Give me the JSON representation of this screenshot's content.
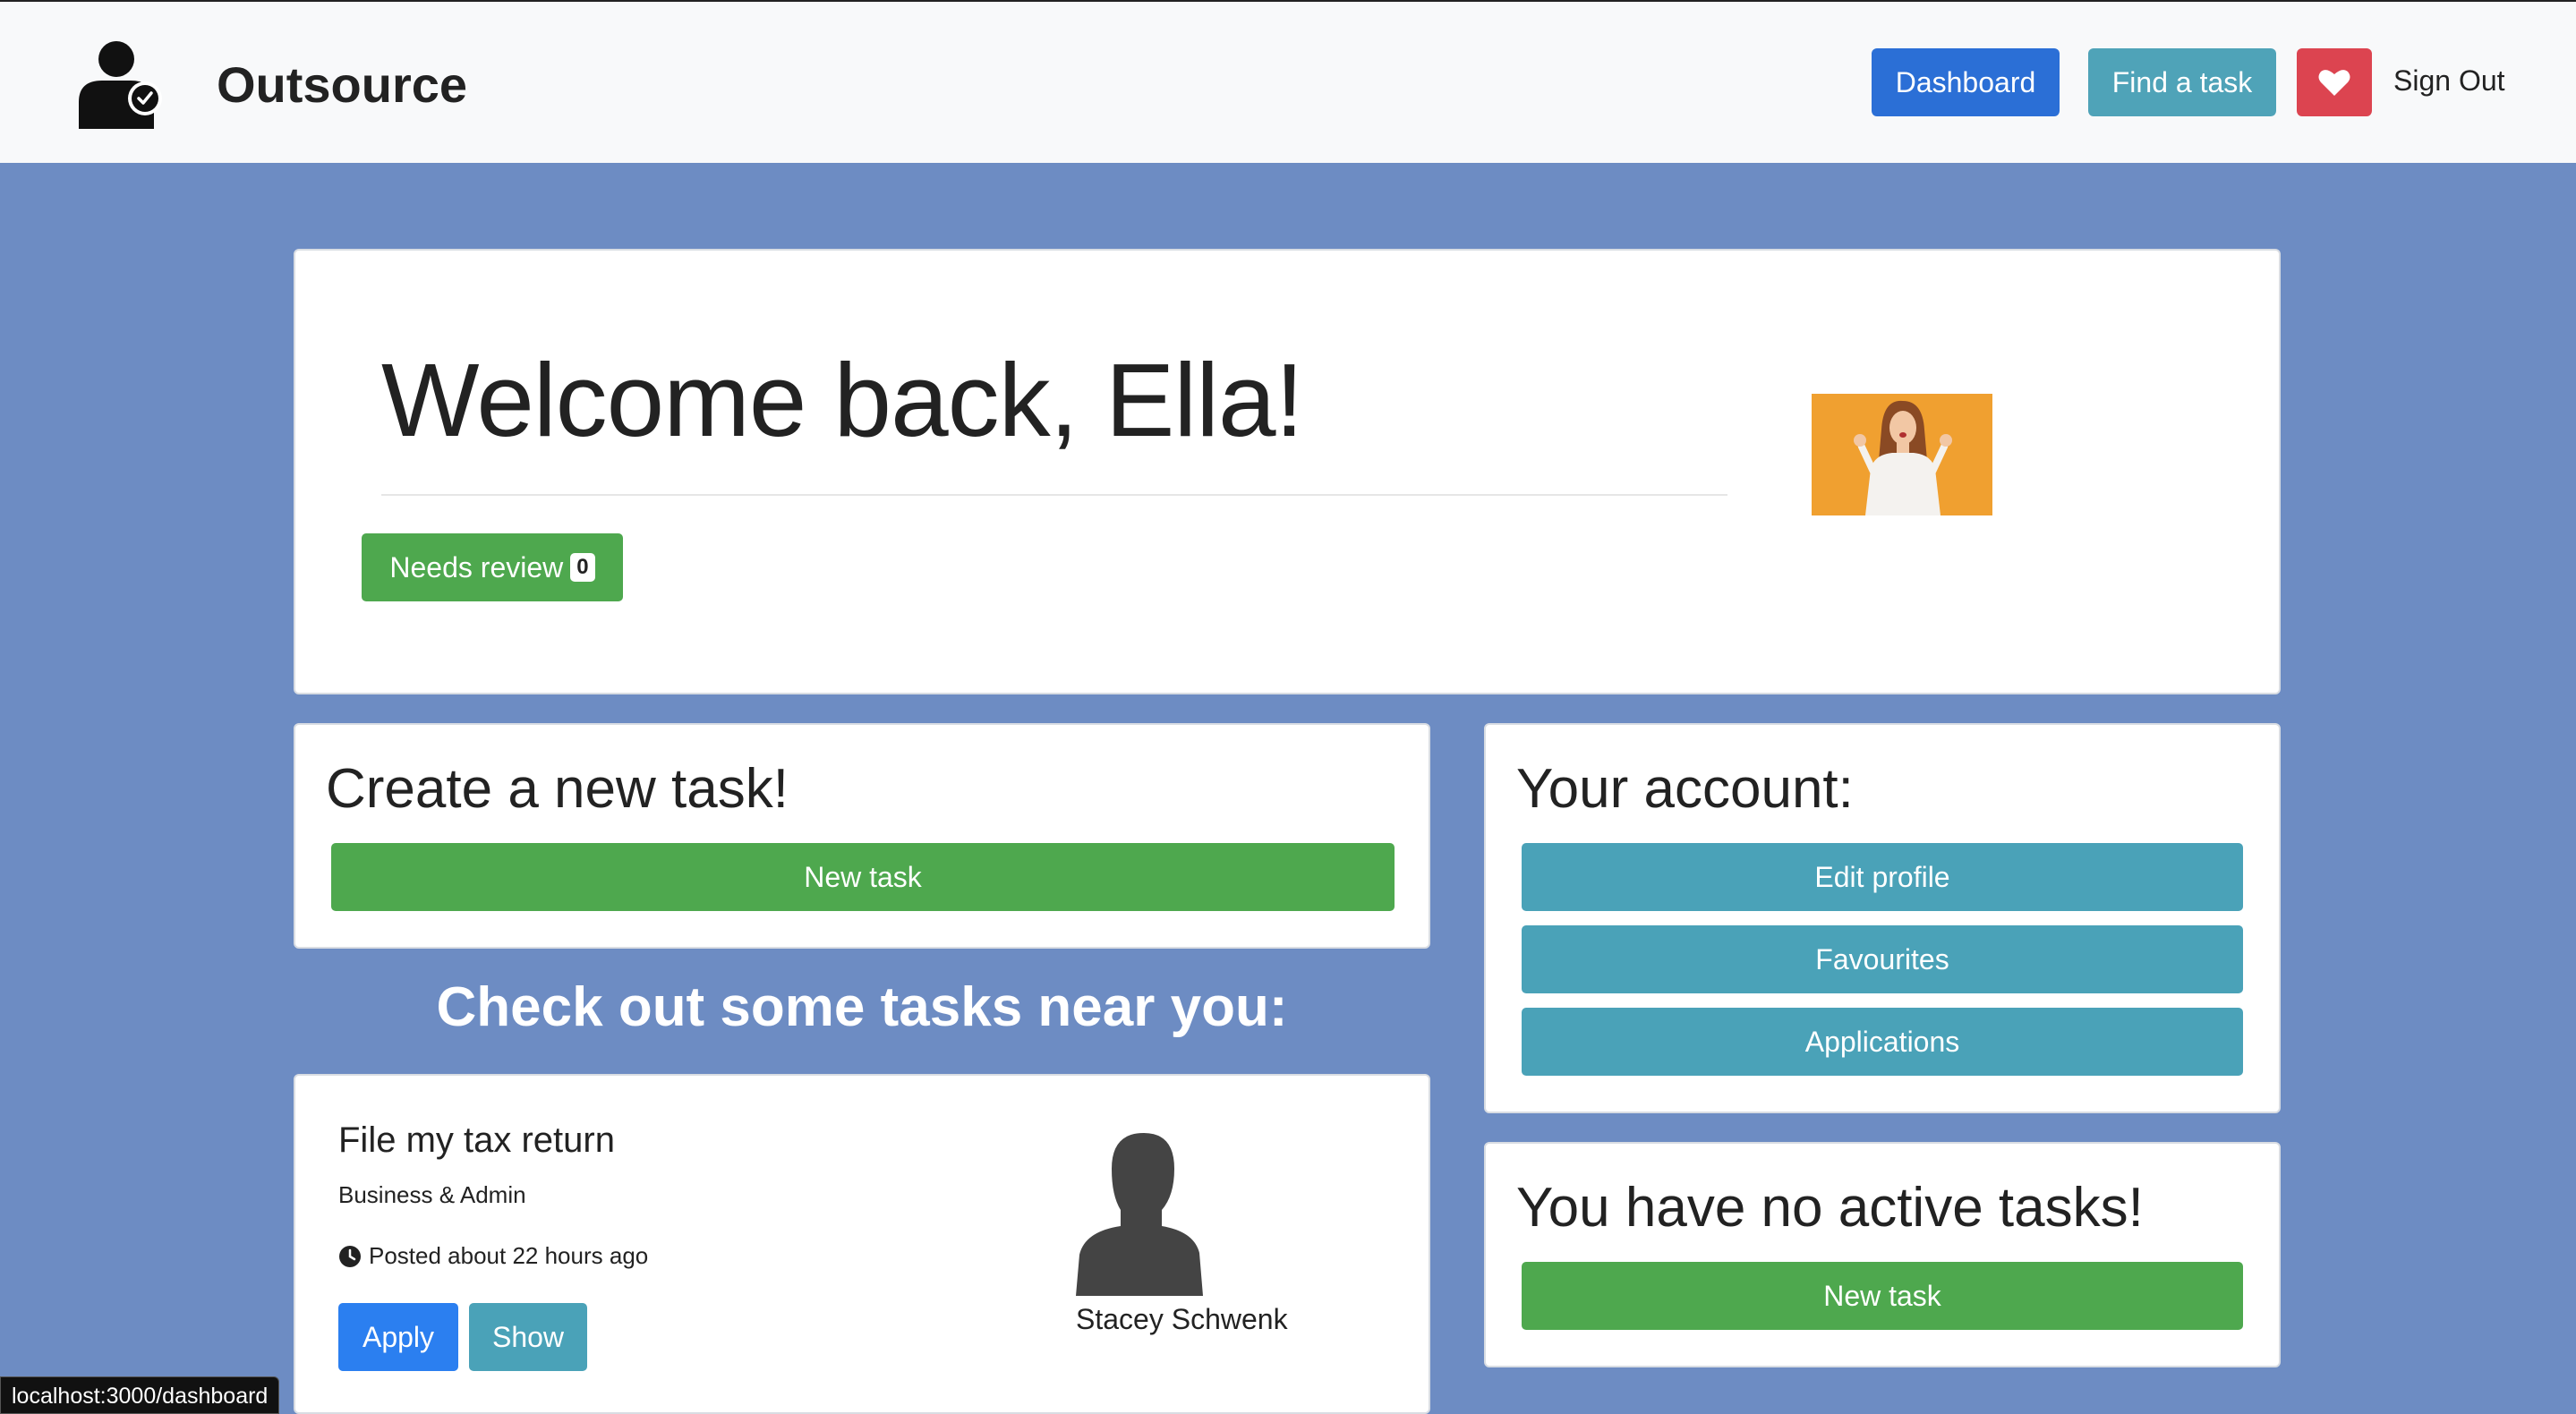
{
  "navbar": {
    "brand": "Outsource",
    "dashboard_label": "Dashboard",
    "find_task_label": "Find a task",
    "favourites_icon": "heart-icon",
    "sign_out_label": "Sign Out",
    "accent": "#2b6fd6"
  },
  "welcome": {
    "title": "Welcome back, Ella!",
    "review_label": "Needs review",
    "review_count": "0"
  },
  "create_task": {
    "heading": "Create a new task!",
    "button_label": "New task"
  },
  "account": {
    "heading": "Your account:",
    "buttons": [
      "Edit profile",
      "Favourites",
      "Applications"
    ]
  },
  "active_tasks": {
    "heading": "You have no active tasks!",
    "button_label": "New task"
  },
  "nearby": {
    "heading": "Check out some tasks near you:",
    "tasks": [
      {
        "title": "File my tax return",
        "category": "Business & Admin",
        "posted": "Posted about 22 hours ago",
        "apply_label": "Apply",
        "show_label": "Show",
        "poster_name": "Stacey Schwenk"
      }
    ]
  },
  "status_bar": {
    "url": "localhost:3000/dashboard"
  },
  "colors": {
    "background": "#6d8cc3",
    "success": "#4ea84e",
    "info": "#4aa2b8",
    "danger": "#dc4450",
    "primary": "#2b7ff0"
  }
}
